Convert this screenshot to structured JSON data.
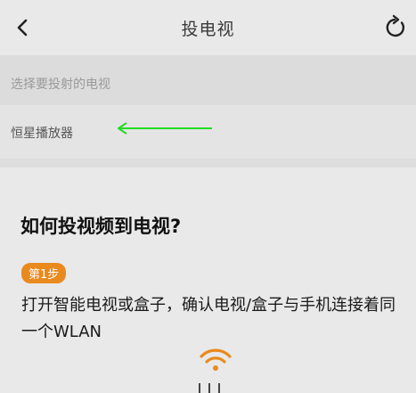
{
  "header": {
    "back_icon": "chevron-left-icon",
    "title": "投电视",
    "refresh_icon": "refresh-icon"
  },
  "select_hint": "选择要投射的电视",
  "devices": [
    {
      "name": "恒星播放器"
    }
  ],
  "annotation": {
    "arrow_color": "#22dd22"
  },
  "guide": {
    "title": "如何投视频到电视?",
    "step_badge": "第1步",
    "step_text": "打开智能电视或盒子，确认电视/盒子与手机连接着同一个WLAN",
    "accent_color": "#e98a1e"
  }
}
